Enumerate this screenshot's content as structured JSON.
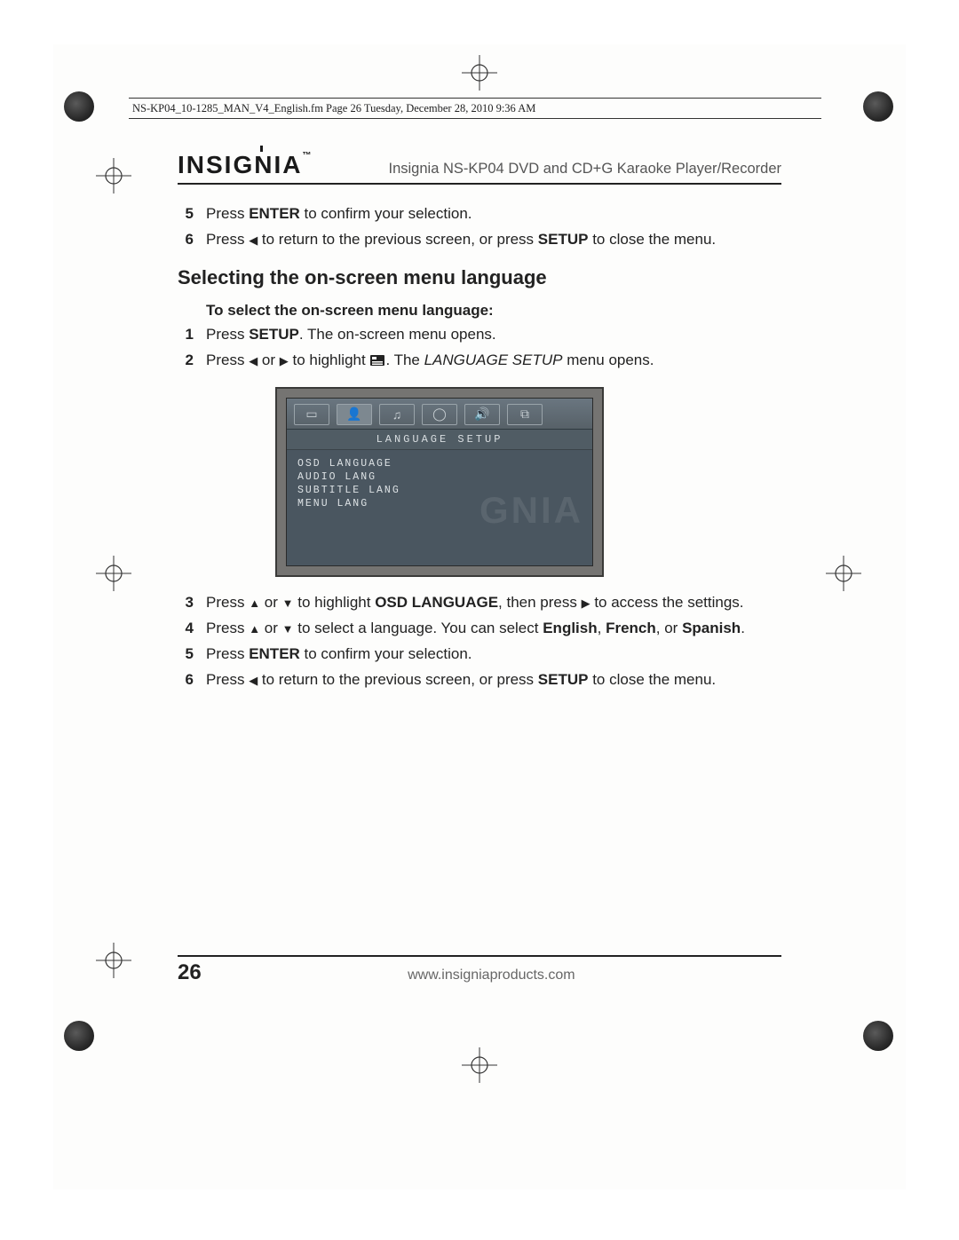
{
  "file_info": "NS-KP04_10-1285_MAN_V4_English.fm  Page 26  Tuesday, December 28, 2010  9:36 AM",
  "brand": "INSIGNIA",
  "brand_tm": "™",
  "doc_title": "Insignia NS-KP04 DVD and CD+G Karaoke Player/Recorder",
  "top_steps": [
    {
      "n": "5",
      "pre": "Press ",
      "b1": "ENTER",
      "post": " to confirm your selection."
    },
    {
      "n": "6",
      "pre": "Press ",
      "arrow": "◀",
      "mid": " to return to the previous screen, or press ",
      "b1": "SETUP",
      "post": " to close the menu."
    }
  ],
  "section_heading": "Selecting the on-screen menu language",
  "sub_heading": "To select the on-screen menu language:",
  "main_steps": [
    {
      "n": "1",
      "parts": [
        {
          "t": "Press "
        },
        {
          "b": "SETUP"
        },
        {
          "t": ". The on-screen menu opens."
        }
      ]
    },
    {
      "n": "2",
      "parts": [
        {
          "t": "Press "
        },
        {
          "a": "◀"
        },
        {
          "t": " or "
        },
        {
          "a": "▶"
        },
        {
          "t": " to highlight "
        },
        {
          "icon": true
        },
        {
          "t": ". The "
        },
        {
          "i": "LANGUAGE SETUP"
        },
        {
          "t": " menu opens."
        }
      ]
    },
    {
      "n": "3",
      "parts": [
        {
          "t": "Press "
        },
        {
          "a": "▲"
        },
        {
          "t": " or "
        },
        {
          "a": "▼"
        },
        {
          "t": " to highlight "
        },
        {
          "b": "OSD LANGUAGE"
        },
        {
          "t": ", then press "
        },
        {
          "a": "▶"
        },
        {
          "t": " to access the settings."
        }
      ]
    },
    {
      "n": "4",
      "parts": [
        {
          "t": "Press "
        },
        {
          "a": "▲"
        },
        {
          "t": " or "
        },
        {
          "a": "▼"
        },
        {
          "t": " to select a language. You can select "
        },
        {
          "b": "English"
        },
        {
          "t": ", "
        },
        {
          "b": "French"
        },
        {
          "t": ", or "
        },
        {
          "b": "Spanish"
        },
        {
          "t": "."
        }
      ]
    },
    {
      "n": "5",
      "parts": [
        {
          "t": "Press "
        },
        {
          "b": "ENTER"
        },
        {
          "t": " to confirm your selection."
        }
      ]
    },
    {
      "n": "6",
      "parts": [
        {
          "t": "Press "
        },
        {
          "a": "◀"
        },
        {
          "t": " to return to the previous screen, or press "
        },
        {
          "b": "SETUP"
        },
        {
          "t": " to close the menu."
        }
      ]
    }
  ],
  "figure": {
    "title": "LANGUAGE  SETUP",
    "items": [
      "OSD  LANGUAGE",
      "AUDIO  LANG",
      "SUBTITLE  LANG",
      "MENU  LANG"
    ],
    "tabs": [
      "▭",
      "👤",
      "♫",
      "◯",
      "🔊",
      "⧉"
    ],
    "watermark": "GNIA"
  },
  "footer": {
    "page": "26",
    "url": "www.insigniaproducts.com"
  }
}
